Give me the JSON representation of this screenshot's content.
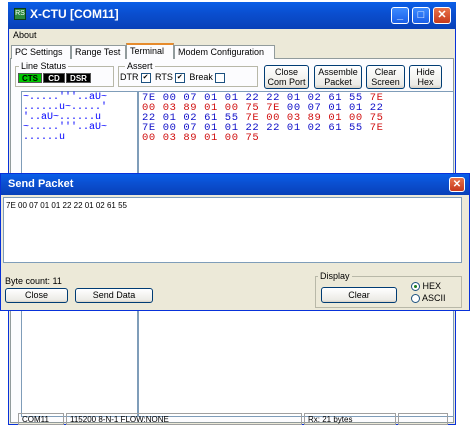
{
  "window": {
    "title": "X-CTU  [COM11]",
    "icon_label": "RS",
    "minimize": "_",
    "maximize": "□",
    "close": "✕"
  },
  "menu": {
    "about": "About"
  },
  "tabs": [
    {
      "label": "PC Settings",
      "active": false
    },
    {
      "label": "Range Test",
      "active": false
    },
    {
      "label": "Terminal",
      "active": true
    },
    {
      "label": "Modem Configuration",
      "active": false
    }
  ],
  "line_status": {
    "label": "Line Status",
    "cts": "CTS",
    "cd": "CD",
    "dsr": "DSR"
  },
  "assert": {
    "label": "Assert",
    "dtr": "DTR",
    "dtr_checked": true,
    "rts": "RTS",
    "rts_checked": true,
    "brk": "Break",
    "brk_checked": false
  },
  "buttons": {
    "close_com": [
      "Close",
      "Com Port"
    ],
    "assemble": [
      "Assemble",
      "Packet"
    ],
    "clear_screen": [
      "Clear",
      "Screen"
    ],
    "hide_hex": [
      "Hide",
      "Hex"
    ]
  },
  "ascii_lines": [
    "~.....'''..aU~",
    "......u~.....'",
    "'..aU~......u",
    "~.....'''..aU~",
    "......u"
  ],
  "hex_lines": [
    [
      [
        "7E 00 07 01 01 22 22 01 02 61 55 ",
        "blue"
      ],
      [
        "7E",
        "red"
      ]
    ],
    [
      [
        "00 03 89 01 00 75 7E ",
        "red"
      ],
      [
        "00 07 01 01 22",
        "blue"
      ]
    ],
    [
      [
        "22 01 02 61 55 ",
        "blue"
      ],
      [
        "7E 00 03 89 01 00 75",
        "red"
      ]
    ],
    [
      [
        "7E 00 07 01 01 22 22 01 02 61 55 ",
        "blue"
      ],
      [
        "7E",
        "red"
      ]
    ],
    [
      [
        "00 03 89 01 00 75",
        "red"
      ]
    ]
  ],
  "dialog": {
    "title": "Send Packet",
    "close": "✕",
    "packet_text": "7E 00 07 01 01 22 22 01 02 61 55",
    "byte_count": "Byte count: 11",
    "close_btn": "Close",
    "send_btn": "Send Data",
    "display_label": "Display",
    "clear_btn": "Clear",
    "hex_label": "HEX",
    "ascii_label": "ASCII",
    "display_mode": "HEX"
  },
  "status": {
    "port": "COM11",
    "settings": "115200 8-N-1  FLOW:NONE",
    "rx": "Rx: 21 bytes"
  },
  "colors": {
    "title_blue": "#0a4fd0",
    "hex_blue": "#1010c8",
    "hex_red": "#d01010",
    "cts_green": "#00c800"
  }
}
